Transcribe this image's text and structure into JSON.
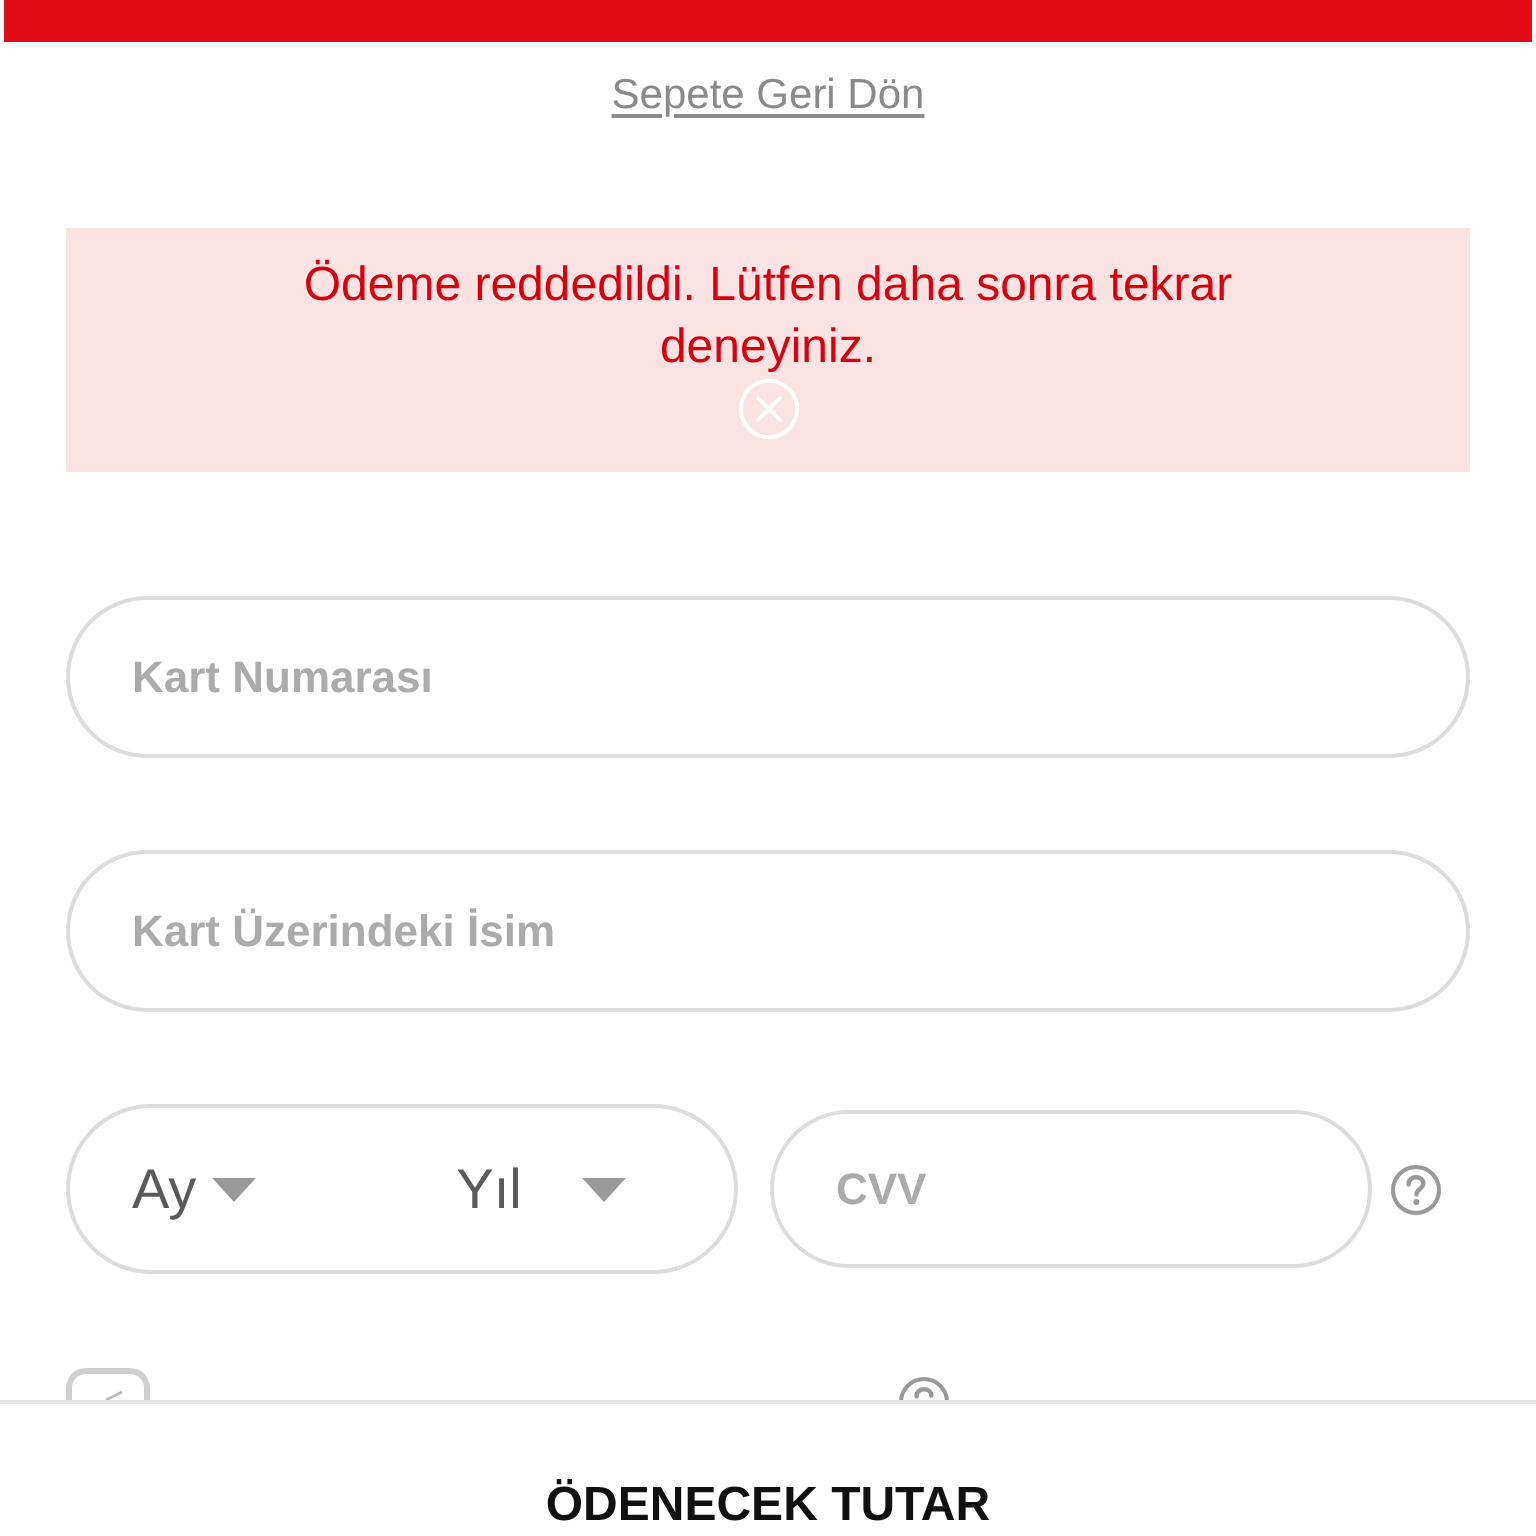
{
  "back_link": "Sepete Geri Dön",
  "alert": {
    "message": "Ödeme reddedildi. Lütfen daha sonra tekrar deneyiniz."
  },
  "fields": [
    {
      "placeholder": "Kart Numarası"
    },
    {
      "placeholder": "Kart Üzerindeki İsim"
    }
  ],
  "expiry": {
    "month": "Ay",
    "year": "Yıl"
  },
  "cvv": {
    "placeholder": "CVV"
  },
  "secure_option": {
    "checked": true
  },
  "summary": {
    "title": "ÖDENECEK TUTAR"
  }
}
